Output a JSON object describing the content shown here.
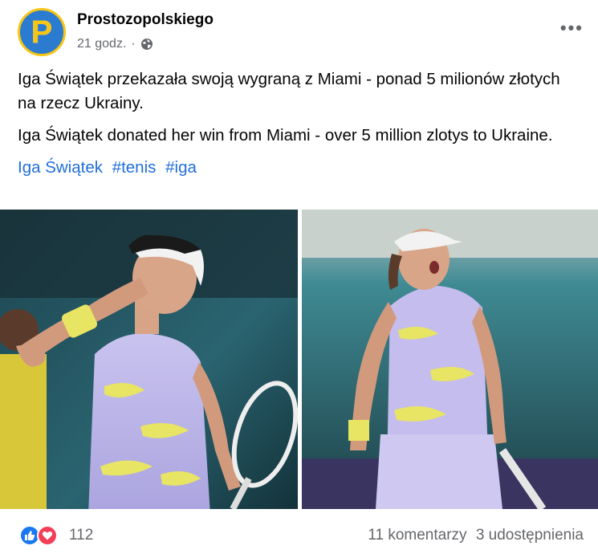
{
  "post": {
    "author": "Prostozopolskiego",
    "time": "21 godz.",
    "separator": "·",
    "avatar_letter": "P",
    "text_pl": "Iga Świątek przekazała swoją wygraną z Miami - ponad 5 milionów złotych na rzecz Ukrainy.",
    "text_en": "Iga Świątek donated her win from Miami - over 5 million zlotys to Ukraine.",
    "tags": [
      "Iga Świątek",
      "#tenis",
      "#iga"
    ]
  },
  "footer": {
    "reaction_count": "112",
    "comments": "11 komentarzy",
    "shares": "3 udostępnienia"
  },
  "icons": [
    "globe-icon",
    "more-icon",
    "like-icon",
    "love-icon"
  ],
  "colors": {
    "link": "#216fdb",
    "like": "#1877f2",
    "love": "#f33e58",
    "avatar_bg": "#2b7bd1",
    "avatar_ring": "#f6c515"
  }
}
